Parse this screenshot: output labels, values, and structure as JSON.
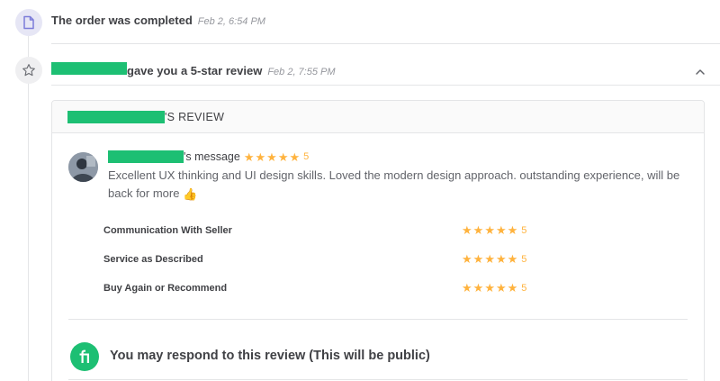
{
  "events": [
    {
      "text": "The order was completed",
      "time": "Feb 2, 6:54 PM",
      "icon": "document-icon"
    },
    {
      "text": "gave you a 5-star review",
      "time": "Feb 2, 7:55 PM",
      "icon": "star-outline-icon"
    }
  ],
  "review": {
    "header_suffix": "'S REVIEW",
    "message_suffix": "'s message",
    "overall_rating": "5",
    "message": "Excellent UX thinking and UI design skills. Loved the modern design approach. outstanding experience, will be back for more",
    "ratings": [
      {
        "label": "Communication With Seller",
        "value": "5"
      },
      {
        "label": "Service as Described",
        "value": "5"
      },
      {
        "label": "Buy Again or Recommend",
        "value": "5"
      }
    ],
    "respond_prompt": "You may respond to this review (This will be public)"
  },
  "colors": {
    "brand_green": "#1dbf73",
    "star_orange": "#ffb33e",
    "text_dark": "#404145",
    "text_muted": "#95979d"
  }
}
